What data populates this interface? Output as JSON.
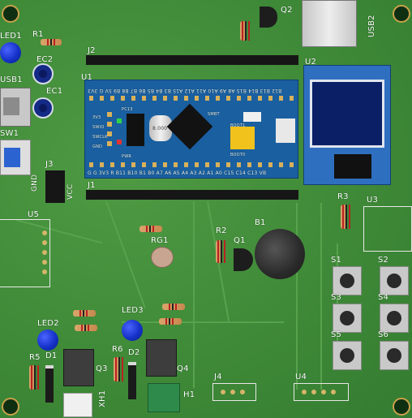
{
  "labels": {
    "led1": "LED1",
    "r1": "R1",
    "ec2": "EC2",
    "usb1": "USB1",
    "ec1": "EC1",
    "sw1": "SW1",
    "j3": "J3",
    "gnd": "GND",
    "vcc": "VCC",
    "u5": "U5",
    "j2": "J2",
    "u1": "U1",
    "j1": "J1",
    "q2": "Q2",
    "usb2": "USB2",
    "u2": "U2",
    "r3": "R3",
    "u3": "U3",
    "b1": "B1",
    "r2": "R2",
    "q1": "Q1",
    "rg1": "RG1",
    "s1": "S1",
    "s2": "S2",
    "s3": "S3",
    "s4": "S4",
    "s5": "S5",
    "s6": "S6",
    "led2": "LED2",
    "led3": "LED3",
    "r5": "R5",
    "d1": "D1",
    "q3": "Q3",
    "r6": "R6",
    "d2": "D2",
    "q4": "Q4",
    "xh1": "XH1",
    "h1": "H1",
    "j4": "J4",
    "u4": "U4"
  },
  "stm32": {
    "top_pins": "B12 B13 B14 B15 A8 A9 A10 A11 A12 A15 B3 B4 B5 B6 B7 B8 B9 5V G 3V3",
    "bottom_pins": "G G 3V3 R B11 B10 B1 B0 A7 A6 A5 A4 A3 A2 A1 A0 C15 C14 C13 VB",
    "chip_text": "8.000",
    "swd_pins": [
      "3V3",
      "SWIO",
      "SWCLK",
      "GND"
    ],
    "pc13": "PC13",
    "pwr": "PWR",
    "boot0": "BOOT0",
    "boot1": "BOOT1",
    "mark": "SMBT"
  },
  "colors": {
    "board": "#3f8a38",
    "stm32_pcb": "#1a5fa0",
    "oled_pcb": "#2f6fc0",
    "led": "#1532c8"
  }
}
